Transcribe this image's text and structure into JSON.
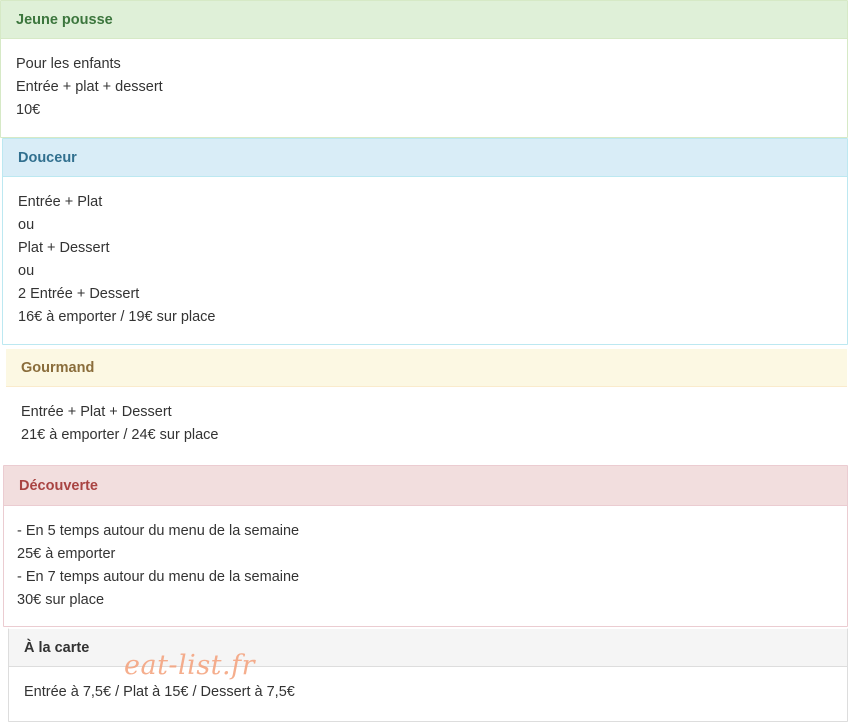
{
  "menus": [
    {
      "title": "Jeune pousse",
      "lines": [
        "Pour les enfants",
        "Entrée + plat + dessert",
        "10€"
      ]
    },
    {
      "title": "Douceur",
      "lines": [
        "Entrée + Plat",
        "ou",
        "Plat + Dessert",
        "ou",
        "2 Entrée + Dessert",
        "16€ à emporter / 19€ sur place"
      ]
    },
    {
      "title": "Gourmand",
      "lines": [
        "Entrée + Plat + Dessert",
        "21€ à emporter / 24€ sur place"
      ]
    },
    {
      "title": "Découverte",
      "lines": [
        "- En 5 temps autour du menu de la semaine",
        "25€ à emporter",
        "- En 7 temps autour du menu de la semaine",
        "30€ sur place"
      ]
    },
    {
      "title": "À la carte",
      "lines": [
        "Entrée à 7,5€ / Plat à 15€ / Dessert à 7,5€"
      ]
    }
  ],
  "watermark": "eat-list.fr",
  "colors": {
    "success_heading_bg": "#dff0d8",
    "success_heading_text": "#3c763d",
    "info_heading_bg": "#d9edf7",
    "info_heading_text": "#31708f",
    "warning_heading_bg": "#fcf8e3",
    "warning_heading_text": "#8a6d3b",
    "danger_heading_bg": "#f2dede",
    "danger_heading_text": "#a94442",
    "default_heading_bg": "#f5f5f5",
    "watermark": "#f4a07a"
  }
}
